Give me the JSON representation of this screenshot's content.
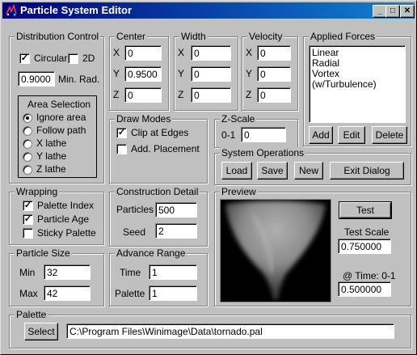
{
  "window": {
    "title": "Particle System Editor",
    "controls": {
      "minimize": "_",
      "maximize": "□",
      "close": "✕"
    }
  },
  "distribution": {
    "title": "Distribution Control",
    "circular_label": "Circular",
    "circular_checked": true,
    "twod_label": "2D",
    "twod_checked": false,
    "min_rad_value": "0.9000",
    "min_rad_label": "Min. Rad.",
    "area_title": "Area Selection",
    "area_options": [
      "Ignore area",
      "Follow path",
      "X lathe",
      "Y lathe",
      "Z lathe"
    ],
    "area_selected": 0
  },
  "center": {
    "title": "Center",
    "x_label": "X",
    "y_label": "Y",
    "z_label": "Z",
    "x": "0",
    "y": "0.9500",
    "z": "0"
  },
  "width": {
    "title": "Width",
    "x_label": "X",
    "y_label": "Y",
    "z_label": "Z",
    "x": "0",
    "y": "0",
    "z": "0"
  },
  "velocity": {
    "title": "Velocity",
    "x_label": "X",
    "y_label": "Y",
    "z_label": "Z",
    "x": "0",
    "y": "0",
    "z": "0"
  },
  "forces": {
    "title": "Applied Forces",
    "items": [
      "Linear",
      "Radial",
      "Vortex (w/Turbulence)"
    ],
    "add_label": "Add",
    "edit_label": "Edit",
    "delete_label": "Delete"
  },
  "draw_modes": {
    "title": "Draw Modes",
    "clip_label": "Clip at Edges",
    "clip_checked": true,
    "add_label": "Add. Placement",
    "add_checked": false
  },
  "zscale": {
    "title": "Z-Scale",
    "range_label": "0-1",
    "value": "0"
  },
  "system_ops": {
    "title": "System Operations",
    "load_label": "Load",
    "save_label": "Save",
    "new_label": "New",
    "exit_label": "Exit Dialog"
  },
  "wrapping": {
    "title": "Wrapping",
    "palette_index_label": "Palette Index",
    "palette_index_checked": true,
    "particle_age_label": "Particle Age",
    "particle_age_checked": true,
    "sticky_label": "Sticky Palette",
    "sticky_checked": false
  },
  "construction": {
    "title": "Construction Detail",
    "particles_label": "Particles",
    "particles": "500",
    "seed_label": "Seed",
    "seed": "2"
  },
  "particle_size": {
    "title": "Particle Size",
    "min_label": "Min",
    "min": "32",
    "max_label": "Max",
    "max": "42"
  },
  "advance": {
    "title": "Advance Range",
    "time_label": "Time",
    "time": "1",
    "palette_label": "Palette",
    "palette": "1"
  },
  "preview": {
    "title": "Preview",
    "test_label": "Test",
    "test_scale_label": "Test Scale",
    "test_scale": "0.750000",
    "time_label": "@ Time: 0-1",
    "time": "0.500000"
  },
  "palette": {
    "title": "Palette",
    "select_label": "Select",
    "path": "C:\\Program Files\\Winimage\\Data\\tornado.pal"
  }
}
